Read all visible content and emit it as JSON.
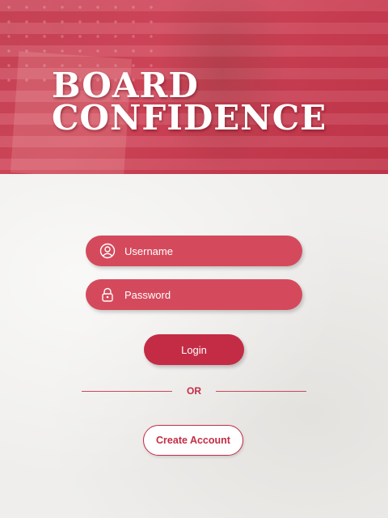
{
  "header": {
    "title_line1": "BOARD",
    "title_line2": "CONFIDENCE"
  },
  "form": {
    "username_placeholder": "Username",
    "username_icon": "user-circle-icon",
    "password_placeholder": "Password",
    "password_icon": "lock-icon",
    "login_label": "Login",
    "divider_text": "OR",
    "create_account_label": "Create Account"
  },
  "colors": {
    "brand_red": "#c42c45",
    "field_red": "#d44a5c",
    "background": "#efeeec"
  }
}
